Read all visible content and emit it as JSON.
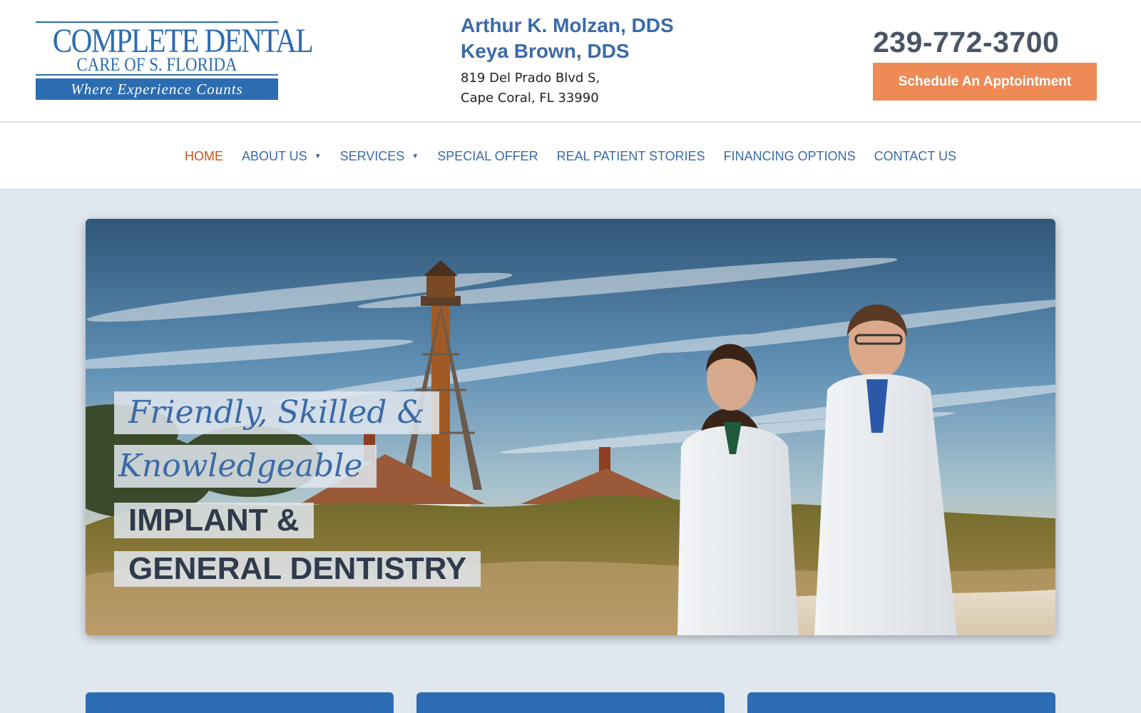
{
  "logo": {
    "line1": "COMPLETE DENTAL",
    "line2": "CARE OF S. FLORIDA",
    "tagline": "Where Experience Counts"
  },
  "practice": {
    "doctor1": "Arthur K. Molzan, DDS",
    "doctor2": "Keya Brown, DDS",
    "address_line1": "819 Del Prado Blvd S,",
    "address_line2": "Cape Coral, FL 33990"
  },
  "contact": {
    "phone": "239-772-3700",
    "appointment_label": "Schedule An Apptointment"
  },
  "nav": {
    "items": [
      {
        "label": "HOME"
      },
      {
        "label": "ABOUT US"
      },
      {
        "label": "SERVICES"
      },
      {
        "label": "SPECIAL OFFER"
      },
      {
        "label": "REAL PATIENT STORIES"
      },
      {
        "label": "FINANCING OPTIONS"
      },
      {
        "label": "CONTACT US"
      }
    ],
    "dropdown_caret": "▼"
  },
  "hero": {
    "script_line1": "Friendly, Skilled &",
    "script_line2": "Knowledgeable",
    "headline_line1": "IMPLANT &",
    "headline_line2": "GENERAL DENTISTRY"
  },
  "colors": {
    "brand_blue": "#2c6cb0",
    "nav_text": "#3a6aa8",
    "nav_active": "#c4541e",
    "cta_orange": "#ef8a56",
    "page_bg": "#dfe7ef"
  },
  "icons": {
    "dropdown": "caret-down-icon"
  }
}
